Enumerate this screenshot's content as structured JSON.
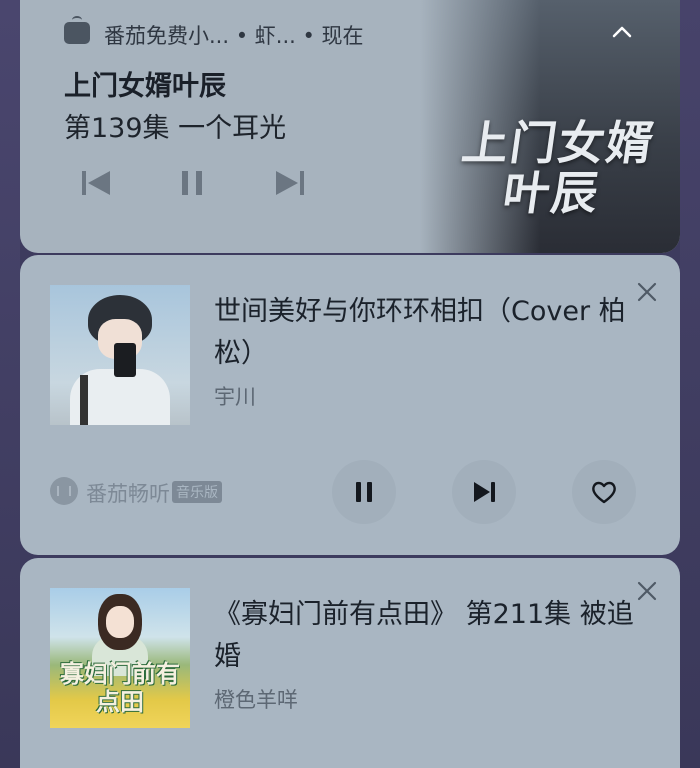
{
  "media_card": {
    "app_meta": "番茄免费小... • 虾... • 现在",
    "title": "上门女婿叶辰",
    "episode": "第139集 一个耳光",
    "cover_text": "上门女婿叶辰",
    "controls": [
      "previous",
      "pause",
      "next"
    ]
  },
  "music_card": {
    "title": "世间美好与你环环相扣（Cover 柏松）",
    "artist": "宇川",
    "brand_name": "番茄畅听",
    "brand_badge": "音乐版",
    "controls": [
      "pause",
      "next",
      "like"
    ]
  },
  "audiobook_card": {
    "title": "《寡妇门前有点田》 第211集 被追婚",
    "artist": "橙色羊咩",
    "cover_text": "寡妇门前有点田"
  },
  "colors": {
    "card_bg": "#a9b6c2",
    "page_bg": "#3d3b5e",
    "text_primary": "#1b222b",
    "text_secondary": "#5d6874"
  }
}
